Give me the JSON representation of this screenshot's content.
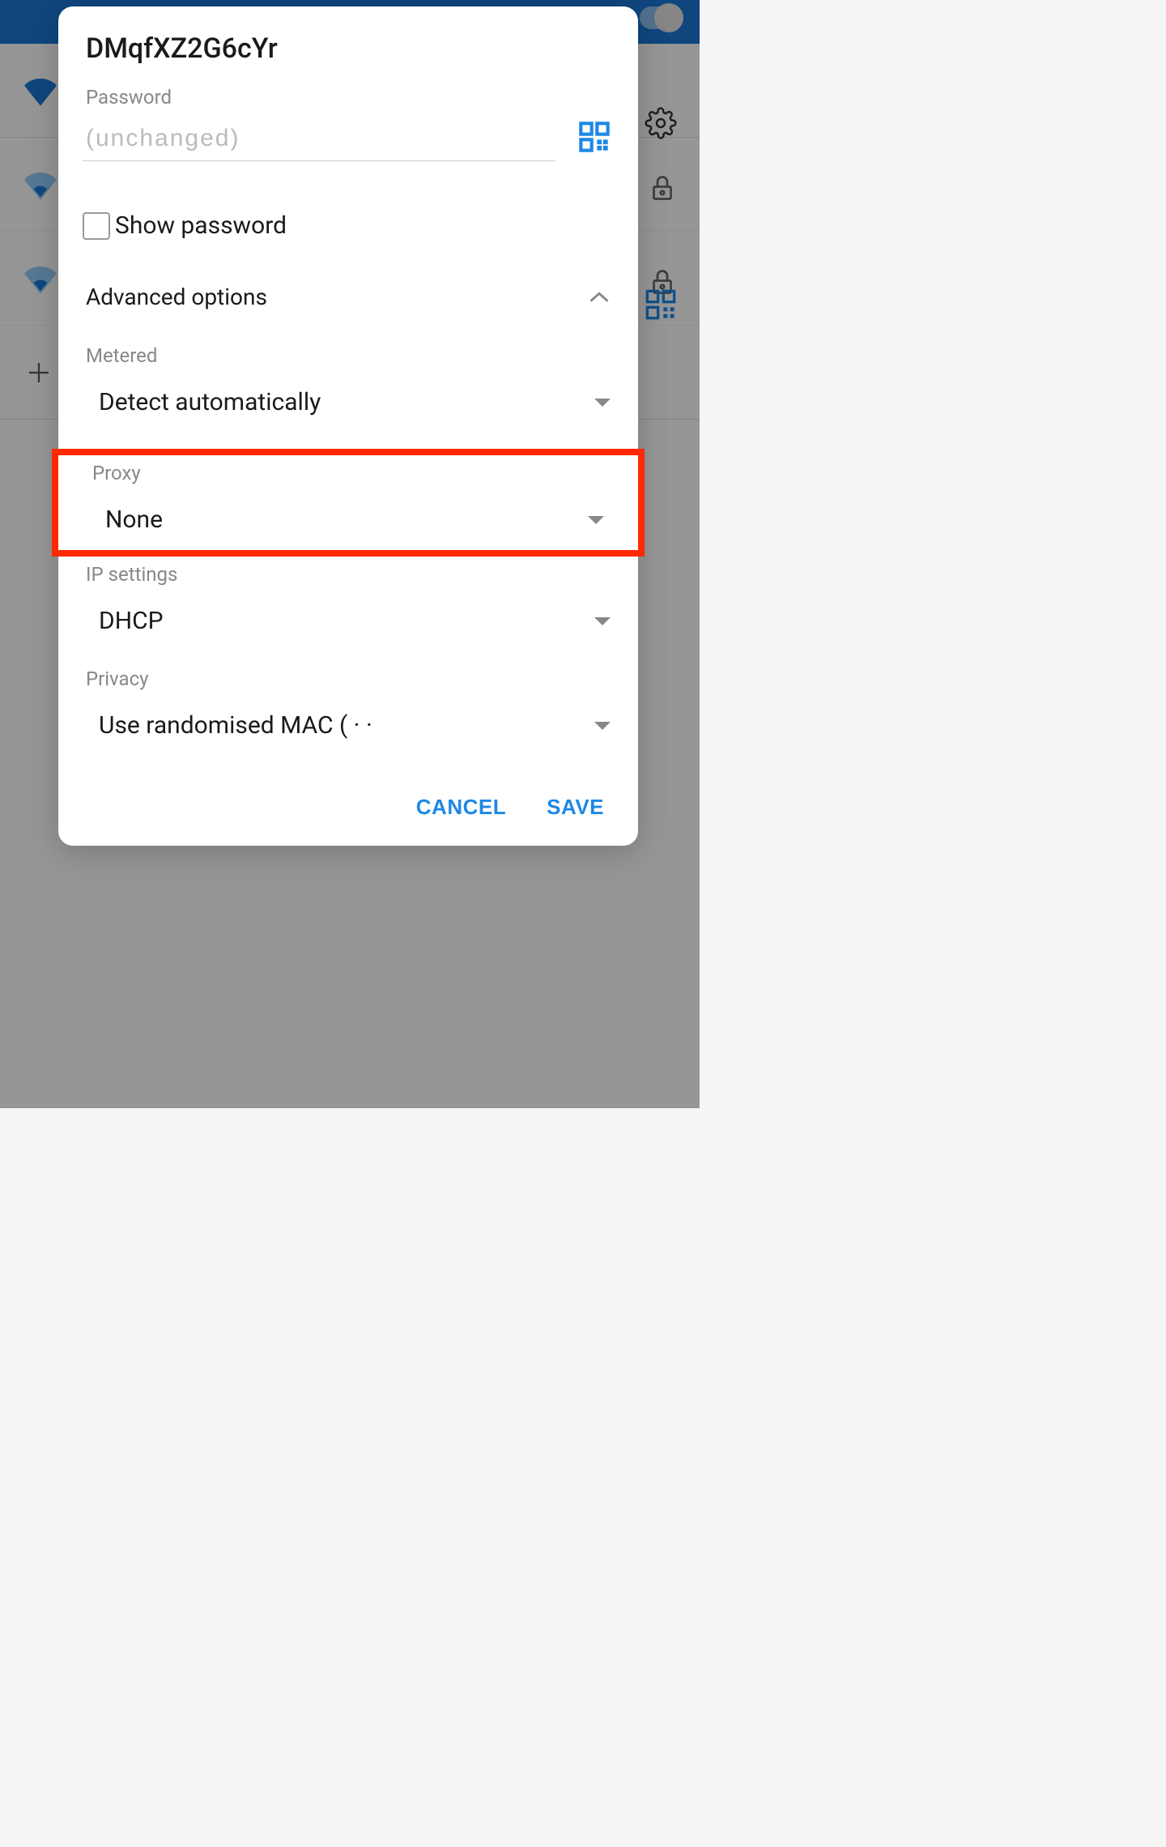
{
  "dialog": {
    "title": "DMqfXZ2G6cYr",
    "password": {
      "label": "Password",
      "placeholder": "(unchanged)"
    },
    "show_password_label": "Show password",
    "advanced_options_label": "Advanced options",
    "metered": {
      "label": "Metered",
      "value": "Detect automatically"
    },
    "proxy": {
      "label": "Proxy",
      "value": "None"
    },
    "ip_settings": {
      "label": "IP settings",
      "value": "DHCP"
    },
    "privacy": {
      "label": "Privacy",
      "value": "Use randomised MAC ( · ·"
    },
    "cancel_label": "CANCEL",
    "save_label": "SAVE"
  },
  "colors": {
    "primary": "#1976d2",
    "accent": "#1e88e5",
    "highlight": "#ff2800"
  }
}
